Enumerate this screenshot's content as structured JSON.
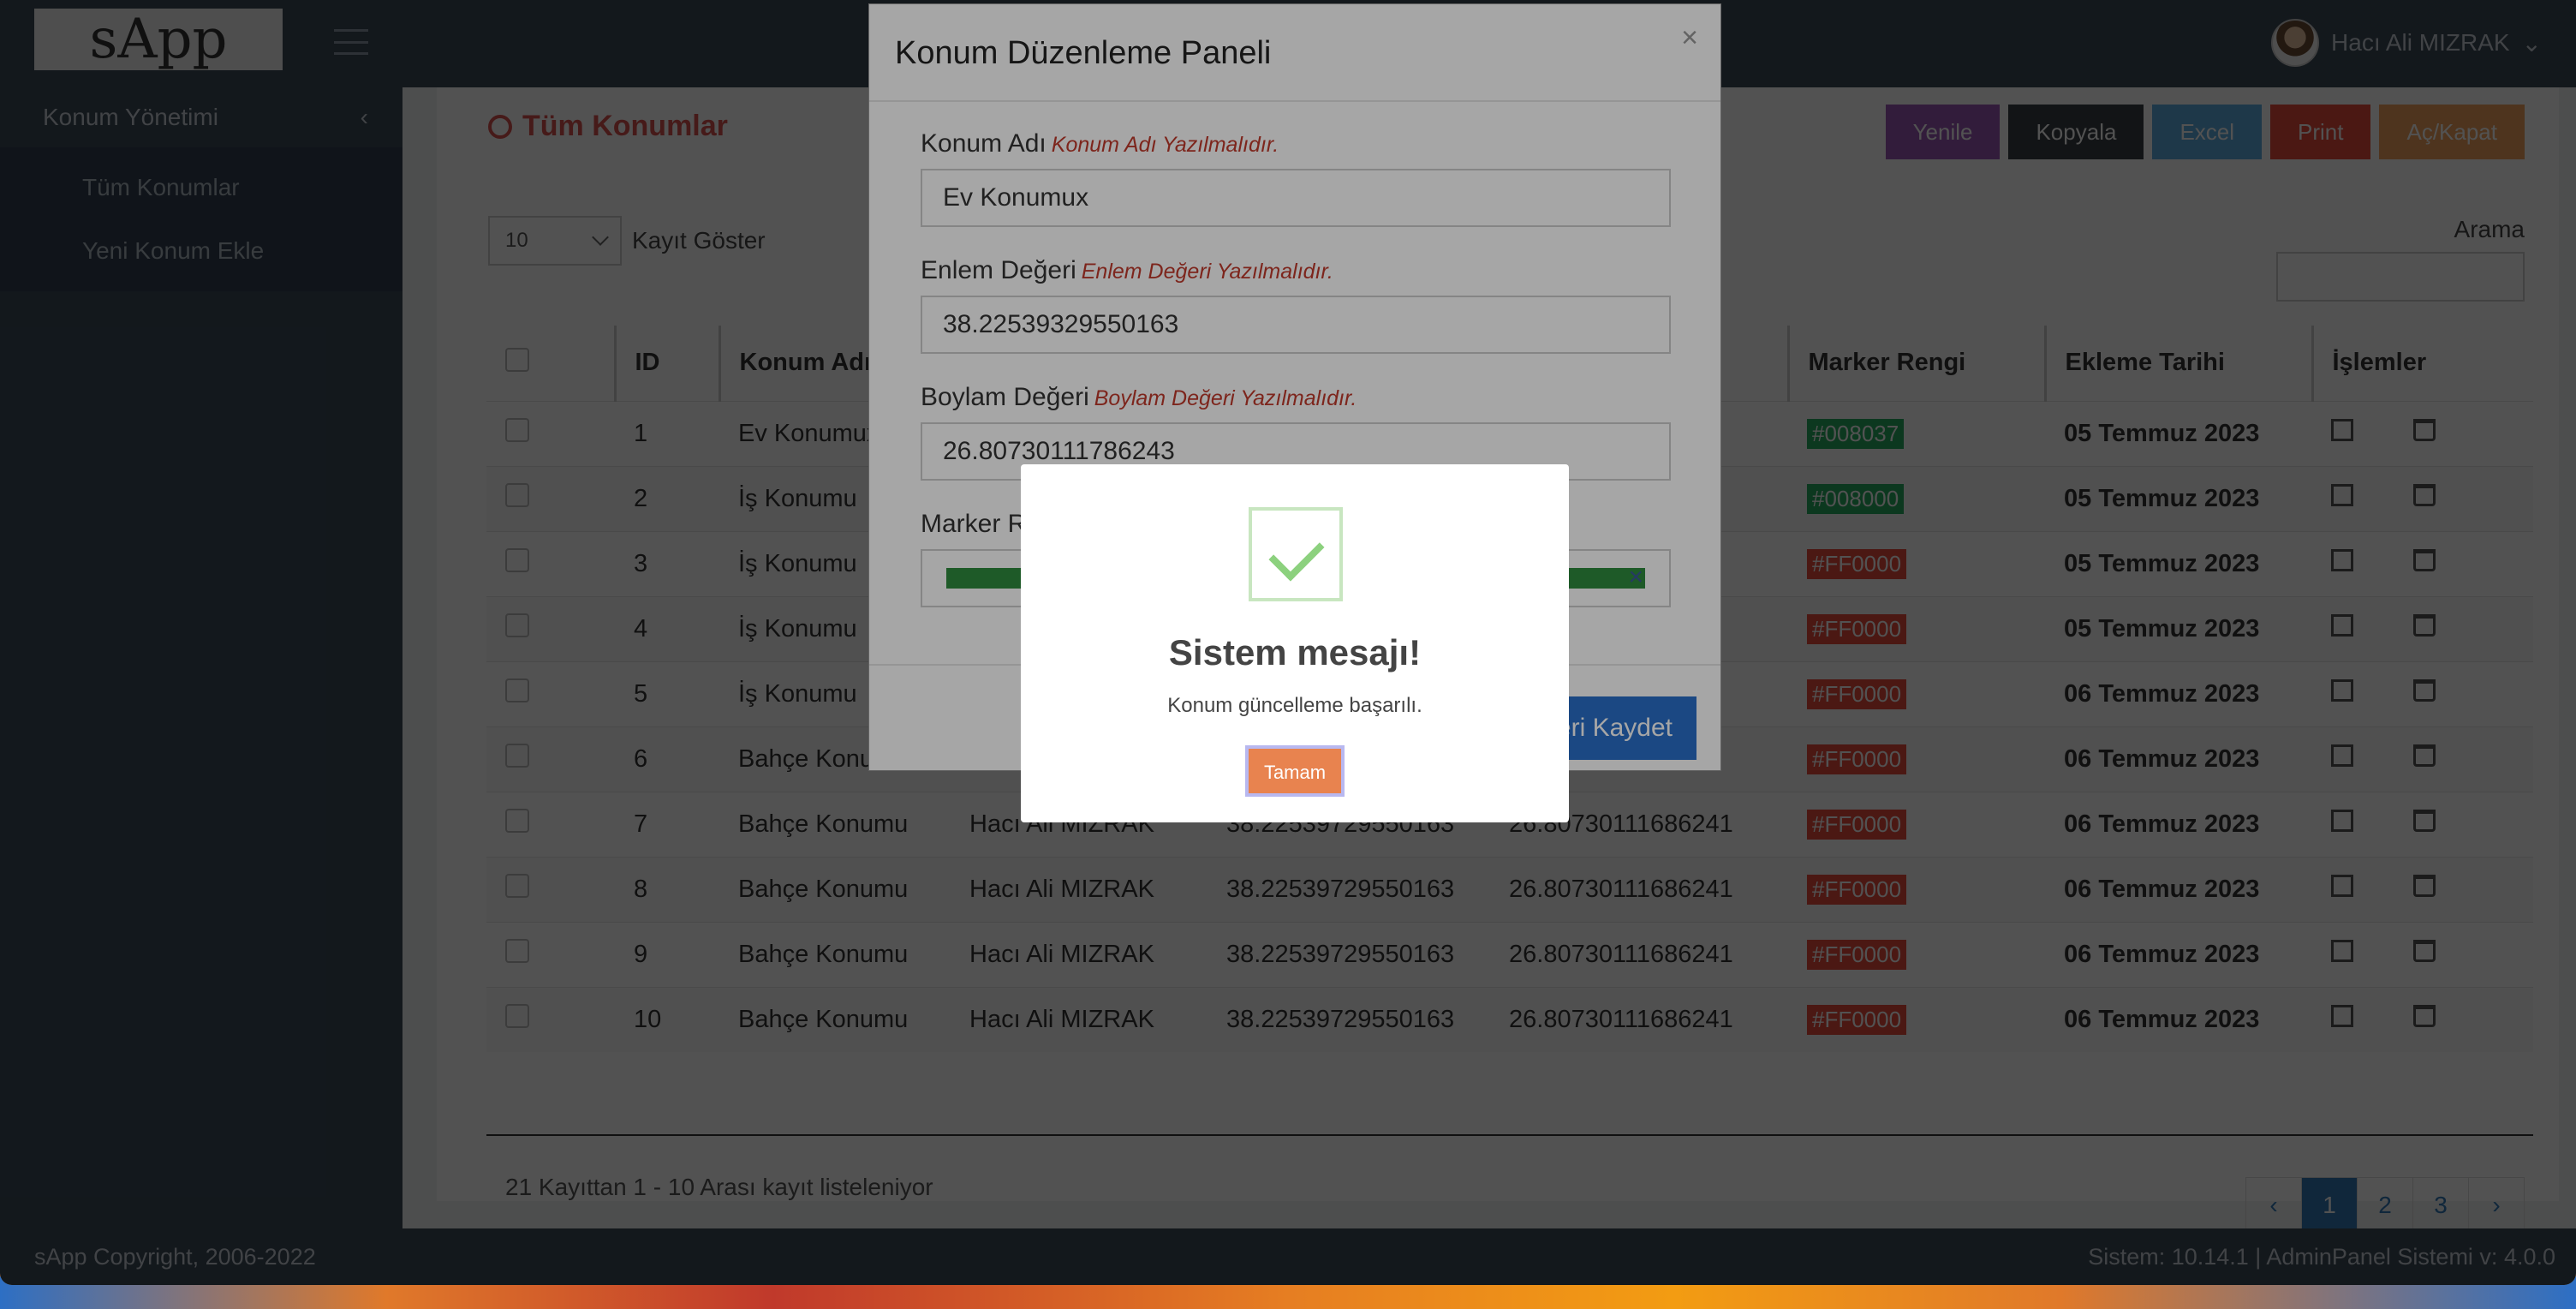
{
  "app": {
    "brand": "sApp",
    "user_name": "Hacı Ali MIZRAK"
  },
  "sidebar": {
    "section": "Konum Yönetimi",
    "items": [
      {
        "label": "Tüm Konumlar"
      },
      {
        "label": "Yeni Konum Ekle"
      }
    ]
  },
  "page": {
    "title": "Tüm Konumlar",
    "buttons": {
      "refresh": "Yenile",
      "copy": "Kopyala",
      "excel": "Excel",
      "print": "Print",
      "toggle": "Aç/Kapat"
    },
    "length_value": "10",
    "length_label": "Kayıt Göster",
    "search_label": "Arama",
    "info": "21 Kayıttan 1 - 10 Arası kayıt listeleniyor",
    "pagination": {
      "prev": "‹",
      "pages": [
        "1",
        "2",
        "3"
      ],
      "next": "›"
    }
  },
  "table": {
    "headers": {
      "id": "ID",
      "name": "Konum Adı",
      "marker": "Marker Rengi",
      "date": "Ekleme Tarihi",
      "actions": "İşlemler"
    },
    "rows": [
      {
        "id": "1",
        "name": "Ev Konumux",
        "user": "",
        "lat": "",
        "lng": "…3",
        "color": "#008037",
        "date": "05 Temmuz 2023"
      },
      {
        "id": "2",
        "name": "İş Konumu",
        "user": "",
        "lat": "",
        "lng": "…7",
        "color": "#008000",
        "date": "05 Temmuz 2023"
      },
      {
        "id": "3",
        "name": "İş Konumu",
        "user": "",
        "lat": "",
        "lng": "",
        "color": "#FF0000",
        "date": "05 Temmuz 2023"
      },
      {
        "id": "4",
        "name": "İş Konumu",
        "user": "",
        "lat": "",
        "lng": "…1",
        "color": "#FF0000",
        "date": "05 Temmuz 2023"
      },
      {
        "id": "5",
        "name": "İş Konumu",
        "user": "",
        "lat": "",
        "lng": "…1",
        "color": "#FF0000",
        "date": "06 Temmuz 2023"
      },
      {
        "id": "6",
        "name": "Bahçe Konumu",
        "user": "",
        "lat": "",
        "lng": "…1",
        "color": "#FF0000",
        "date": "06 Temmuz 2023"
      },
      {
        "id": "7",
        "name": "Bahçe Konumu",
        "user": "Hacı Ali MIZRAK",
        "lat": "38.22539729550163",
        "lng": "26.80730111686241",
        "color": "#FF0000",
        "date": "06 Temmuz 2023"
      },
      {
        "id": "8",
        "name": "Bahçe Konumu",
        "user": "Hacı Ali MIZRAK",
        "lat": "38.22539729550163",
        "lng": "26.80730111686241",
        "color": "#FF0000",
        "date": "06 Temmuz 2023"
      },
      {
        "id": "9",
        "name": "Bahçe Konumu",
        "user": "Hacı Ali MIZRAK",
        "lat": "38.22539729550163",
        "lng": "26.80730111686241",
        "color": "#FF0000",
        "date": "06 Temmuz 2023"
      },
      {
        "id": "10",
        "name": "Bahçe Konumu",
        "user": "Hacı Ali MIZRAK",
        "lat": "38.22539729550163",
        "lng": "26.80730111686241",
        "color": "#FF0000",
        "date": "06 Temmuz 2023"
      }
    ]
  },
  "footer": {
    "copyright": "sApp Copyright, 2006-2022",
    "version": "Sistem: 10.14.1 | AdminPanel Sistemi v: 4.0.0"
  },
  "modal": {
    "title": "Konum Düzenleme Paneli",
    "close": "×",
    "name_label": "Konum Adı",
    "name_error": "Konum Adı Yazılmalıdır.",
    "name_value": "Ev Konumux",
    "lat_label": "Enlem Değeri",
    "lat_error": "Enlem Değeri Yazılmalıdır.",
    "lat_value": "38.22539329550163",
    "lng_label": "Boylam Değeri",
    "lng_error": "Boylam Değeri Yazılmalıdır.",
    "lng_value": "26.80730111786243",
    "marker_label": "Marker R",
    "marker_color": "#2e8b3e",
    "marker_clear": "×",
    "save_label": "eri Kaydet"
  },
  "alert": {
    "title": "Sistem mesajı!",
    "message": "Konum güncelleme başarılı.",
    "ok": "Tamam"
  }
}
